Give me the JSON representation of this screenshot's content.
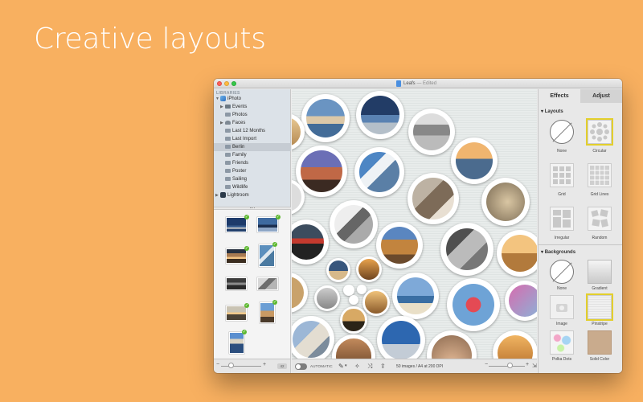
{
  "headline": "Creative layouts",
  "window": {
    "title": "Leafs",
    "title_suffix": " — Edited"
  },
  "sidebar": {
    "header": "LIBRARIES",
    "items": [
      {
        "label": "iPhoto",
        "type": "app"
      },
      {
        "label": "Events",
        "type": "group"
      },
      {
        "label": "Photos",
        "type": "folder"
      },
      {
        "label": "Faces",
        "type": "group"
      },
      {
        "label": "Last 12 Months",
        "type": "folder"
      },
      {
        "label": "Last Import",
        "type": "folder"
      },
      {
        "label": "Berlin",
        "type": "folder",
        "selected": true
      },
      {
        "label": "Family",
        "type": "folder"
      },
      {
        "label": "Friends",
        "type": "folder"
      },
      {
        "label": "Poster",
        "type": "folder"
      },
      {
        "label": "Sailing",
        "type": "folder"
      },
      {
        "label": "Wildlife",
        "type": "folder"
      },
      {
        "label": "Lightroom",
        "type": "app"
      }
    ]
  },
  "browser": {
    "count_badge": "42"
  },
  "bottom_bar": {
    "auto_label": "AUTOMATIC",
    "status": "50 images / A4 at 200 DPI"
  },
  "inspector": {
    "tabs": [
      "Effects",
      "Adjust"
    ],
    "active_tab": "Effects",
    "layouts_title": "Layouts",
    "layouts": [
      {
        "label": "None"
      },
      {
        "label": "Circular",
        "selected": true
      },
      {
        "label": "Grid"
      },
      {
        "label": "Grid Lines"
      },
      {
        "label": "Irregular"
      },
      {
        "label": "Random"
      }
    ],
    "backgrounds_title": "Backgrounds",
    "backgrounds": [
      {
        "label": "None"
      },
      {
        "label": "Gradient"
      },
      {
        "label": "Image"
      },
      {
        "label": "Pinstripe",
        "selected": true
      },
      {
        "label": "Polka Dots"
      },
      {
        "label": "Solid Color"
      }
    ]
  },
  "colors": {
    "background": "#f8b060",
    "selection": "#e3cf2c",
    "check": "#5cb82e"
  }
}
